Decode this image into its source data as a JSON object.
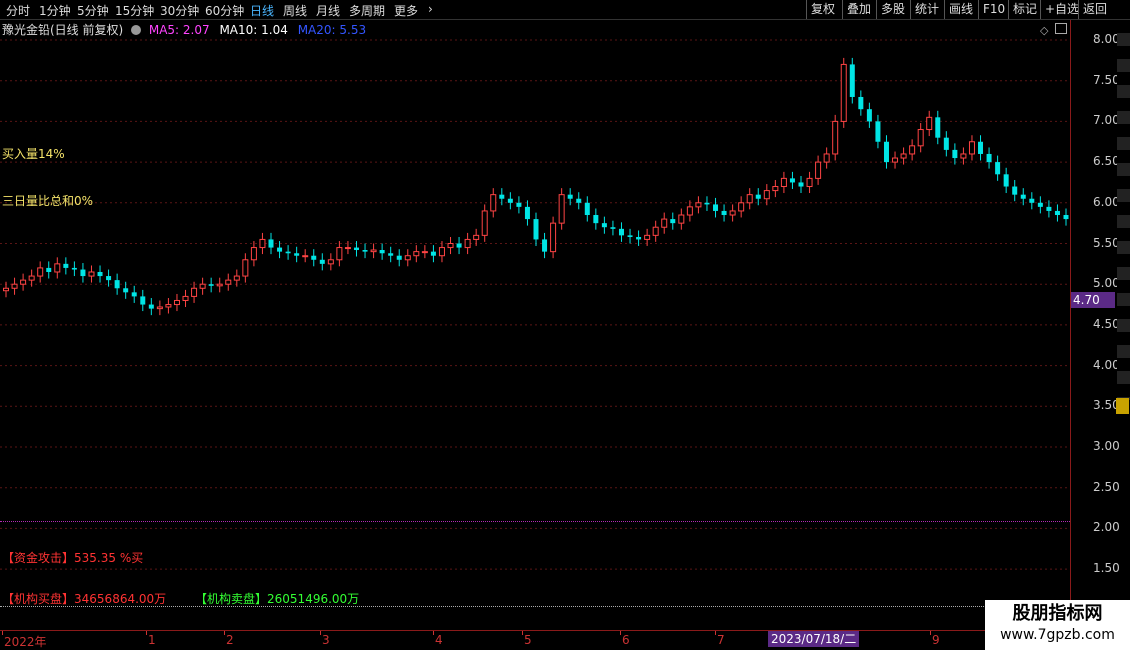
{
  "toolbar": {
    "periods": [
      "分时",
      "1分钟",
      "5分钟",
      "15分钟",
      "30分钟",
      "60分钟",
      "日线",
      "周线",
      "月线",
      "多周期",
      "更多"
    ],
    "active": "日线",
    "right_buttons": [
      "复权",
      "叠加",
      "多股",
      "统计",
      "画线",
      "F10",
      "标记",
      "+自选",
      "返回"
    ]
  },
  "legend": {
    "stock": "豫光金铅(日线 前复权)",
    "ma5_label": "MA5: 2.07",
    "ma10_label": "MA10: 1.04",
    "ma20_label": "MA20: 5.53",
    "colors": {
      "ma5": "#ff44ff",
      "ma10": "#ffffff",
      "ma20": "#3355ff"
    }
  },
  "annotations": {
    "buy_ratio": "买入量14%",
    "three_day": "三日量比总和0%",
    "capital_attack_tag": "【资金攻击】",
    "capital_attack_value": "535.35 %买",
    "inst_buy_tag": "【机构买盘】",
    "inst_buy_value": "34656864.00万",
    "inst_sell_tag": "【机构卖盘】",
    "inst_sell_value": "26051496.00万"
  },
  "price_axis": [
    "8.00",
    "7.50",
    "7.00",
    "6.50",
    "6.00",
    "5.50",
    "5.00",
    "4.50",
    "4.00",
    "3.50",
    "3.00",
    "2.50",
    "2.00",
    "1.50"
  ],
  "current_price": "4.70",
  "x_axis": {
    "labels": [
      "2022年",
      "1",
      "2",
      "3",
      "4",
      "5",
      "6",
      "7",
      "9"
    ],
    "selected_date": "2023/07/18/二"
  },
  "watermark": {
    "line1": "股朋指标网",
    "line2": "www.7gpzb.com"
  },
  "chart_data": {
    "type": "candlestick",
    "title": "豫光金铅(日线 前复权)",
    "ylim": [
      1.2,
      8.2
    ],
    "up_color": "#ff4444",
    "down_color": "#00e5e5",
    "closes": [
      4.95,
      5.0,
      5.05,
      5.1,
      5.2,
      5.15,
      5.25,
      5.2,
      5.18,
      5.1,
      5.15,
      5.1,
      5.05,
      4.95,
      4.9,
      4.85,
      4.75,
      4.7,
      4.72,
      4.75,
      4.8,
      4.85,
      4.95,
      5.0,
      4.98,
      5.0,
      5.05,
      5.1,
      5.3,
      5.45,
      5.55,
      5.45,
      5.4,
      5.38,
      5.35,
      5.35,
      5.3,
      5.25,
      5.3,
      5.45,
      5.45,
      5.42,
      5.4,
      5.42,
      5.38,
      5.35,
      5.3,
      5.35,
      5.4,
      5.4,
      5.35,
      5.45,
      5.5,
      5.45,
      5.55,
      5.6,
      5.9,
      6.1,
      6.05,
      6.0,
      5.95,
      5.8,
      5.55,
      5.4,
      5.75,
      6.1,
      6.05,
      6.0,
      5.85,
      5.75,
      5.7,
      5.68,
      5.6,
      5.58,
      5.55,
      5.6,
      5.7,
      5.8,
      5.75,
      5.85,
      5.95,
      6.0,
      5.98,
      5.9,
      5.85,
      5.9,
      6.0,
      6.1,
      6.05,
      6.15,
      6.2,
      6.3,
      6.25,
      6.2,
      6.3,
      6.5,
      6.6,
      7.0,
      7.7,
      7.3,
      7.15,
      7.0,
      6.75,
      6.5,
      6.55,
      6.6,
      6.7,
      6.9,
      7.05,
      6.8,
      6.65,
      6.55,
      6.6,
      6.75,
      6.6,
      6.5,
      6.35,
      6.2,
      6.1,
      6.05,
      6.0,
      5.95,
      5.9,
      5.85,
      5.8
    ]
  }
}
